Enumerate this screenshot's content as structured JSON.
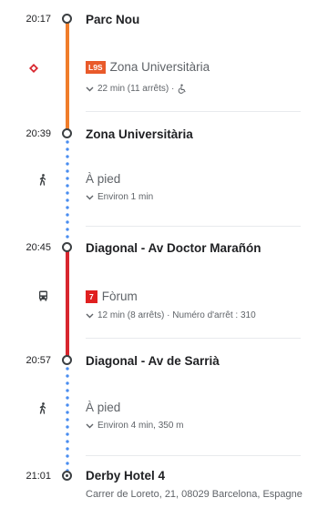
{
  "stops": [
    {
      "time": "20:17",
      "name": "Parc Nou"
    },
    {
      "time": "20:39",
      "name": "Zona Universitària"
    },
    {
      "time": "20:45",
      "name": "Diagonal - Av Doctor Marañón"
    },
    {
      "time": "20:57",
      "name": "Diagonal - Av de Sarrià"
    },
    {
      "time": "21:01",
      "name": "Derby Hotel 4"
    }
  ],
  "legs": [
    {
      "mode": "metro",
      "icon": "metro-icon",
      "badge": "L9S",
      "badge_color": "#e95a2a",
      "line_color": "#f07d2a",
      "destination": "Zona Universitària",
      "detail": "22 min (11 arrêts) ·",
      "accessible_icon": "wheelchair-icon"
    },
    {
      "mode": "walk",
      "icon": "walking-icon",
      "label": "À pied",
      "detail": "Environ 1 min",
      "line_color": "#4a8df0"
    },
    {
      "mode": "bus",
      "icon": "bus-icon",
      "badge": "7",
      "badge_color": "#e02020",
      "line_color": "#d8262e",
      "destination": "Fòrum",
      "detail": "12 min (8 arrêts) · Numéro d'arrêt : 310"
    },
    {
      "mode": "walk",
      "icon": "walking-icon",
      "label": "À pied",
      "detail": "Environ 4 min, 350 m",
      "line_color": "#4a8df0"
    }
  ],
  "destination_address": "Carrer de Loreto, 21, 08029 Barcelona, Espagne"
}
